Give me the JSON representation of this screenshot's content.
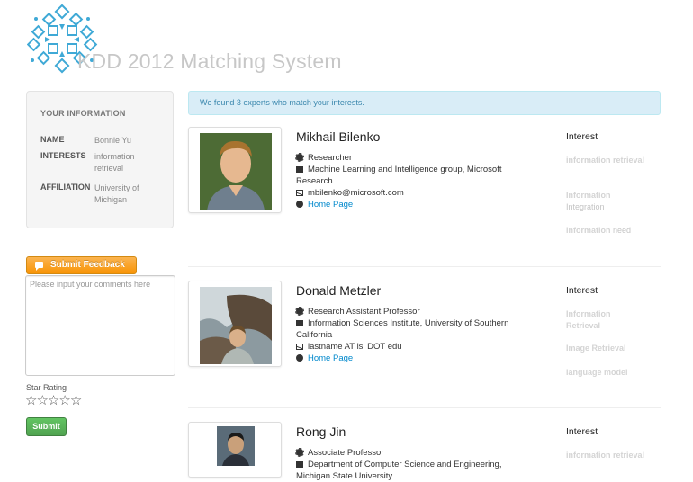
{
  "site": {
    "title": "KDD 2012 Matching System"
  },
  "user_info": {
    "heading": "YOUR INFORMATION",
    "fields": [
      {
        "key": "NAME",
        "value": "Bonnie Yu"
      },
      {
        "key": "INTERESTS",
        "value": "information retrieval"
      },
      {
        "key": "AFFILIATION",
        "value": "University of Michigan"
      }
    ]
  },
  "feedback": {
    "button_label": "Submit Feedback",
    "comment_placeholder": "Please input your comments here",
    "star_label": "Star Rating",
    "star_count": 5,
    "star_glyph": "☆",
    "submit_label": "Submit"
  },
  "results": {
    "message": "We found 3 experts who match your interests.",
    "experts": [
      {
        "name": "Mikhail Bilenko",
        "role": "Researcher",
        "organization": "Machine Learning and Intelligence group, Microsoft Research",
        "email": "mbilenko@microsoft.com",
        "homepage_label": "Home Page",
        "interest_heading": "Interest",
        "interests": [
          {
            "highlight": "information retrieval",
            "rest": ""
          },
          {
            "highlight": "Information",
            "rest": "Integration"
          },
          {
            "highlight": "information",
            "rest": "need"
          }
        ]
      },
      {
        "name": "Donald Metzler",
        "role": "Research Assistant Professor",
        "organization": "Information Sciences Institute, University of Southern California",
        "email": "lastname AT isi DOT edu",
        "homepage_label": "Home Page",
        "interest_heading": "Interest",
        "interests": [
          {
            "highlight": "Information Retrieval",
            "rest": ""
          },
          {
            "highlight": "Image Retrieval",
            "rest": ""
          },
          {
            "highlight": "language model",
            "rest": ""
          }
        ]
      },
      {
        "name": "Rong Jin",
        "role": "Associate Professor",
        "organization": "Department of Computer Science and Engineering, Michigan State University",
        "interest_heading": "Interest",
        "interests": [
          {
            "highlight": "information retrieval",
            "rest": ""
          }
        ]
      }
    ]
  },
  "colors": {
    "alert_bg": "#d9edf7",
    "alert_text": "#3a87ad",
    "feedback_button": "#f89406",
    "submit_button": "#51a351",
    "link": "#0088cc",
    "logo": "#3fa9d6"
  }
}
